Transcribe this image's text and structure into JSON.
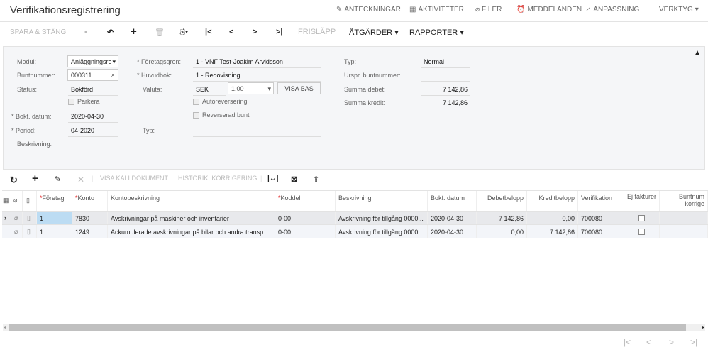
{
  "title": "Verifikationsregistrering",
  "topnav": [
    {
      "icon": "note-icon",
      "label": "ANTECKNINGAR"
    },
    {
      "icon": "calendar-icon",
      "label": "AKTIVITETER"
    },
    {
      "icon": "paperclip-icon",
      "label": "FILER"
    },
    {
      "icon": "alarm-icon",
      "label": "MEDDELANDEN"
    },
    {
      "icon": "customize-icon",
      "label": "ANPASSNING"
    },
    {
      "icon": "chevron-down-icon",
      "label": "VERKTYG"
    }
  ],
  "toolbar": {
    "save_close": "SPARA & STÄNG",
    "release": "FRISLÄPP",
    "actions": "ÅTGÄRDER",
    "reports": "RAPPORTER"
  },
  "form": {
    "modul_label": "Modul:",
    "modul": "Anläggningsre",
    "batch_label": "Buntnummer:",
    "batch": "000311",
    "status_label": "Status:",
    "status": "Bokförd",
    "hold_label": "Parkera",
    "date_label": "Bokf. datum:",
    "date": "2020-04-30",
    "period_label": "Period:",
    "period": "04-2020",
    "desc_label": "Beskrivning:",
    "desc": "",
    "branch_label": "Företagsgren:",
    "branch": "1 - VNF Test-Joakim Arvidsson",
    "ledger_label": "Huvudbok:",
    "ledger": "1 - Redovisning",
    "currency_label": "Valuta:",
    "currency": "SEK",
    "rate": "1,00",
    "view_base": "VISA BAS",
    "autorev_label": "Autoreversering",
    "reversed_label": "Reverserad bunt",
    "typ2_label": "Typ:",
    "typ2": "",
    "type_label": "Typ:",
    "type": "Normal",
    "orig_label": "Urspr. buntnummer:",
    "orig": "",
    "debit_label": "Summa debet:",
    "debit": "7 142,86",
    "credit_label": "Summa kredit:",
    "credit": "7 142,86"
  },
  "grid_toolbar": {
    "view_source": "VISA KÄLLDOKUMENT",
    "history": "HISTORIK, KORRIGERING"
  },
  "columns": [
    "Företag",
    "Konto",
    "Kontobeskrivning",
    "Koddel",
    "Beskrivning",
    "Bokf. datum",
    "Debetbelopp",
    "Kreditbelopp",
    "Verifikation",
    "Ej fakturer",
    "Buntnum korrige"
  ],
  "rows": [
    [
      "1",
      "7830",
      "Avskrivningar på maskiner och inventarier",
      "0-00",
      "Avskrivning för tillgång 0000...",
      "2020-04-30",
      "7 142,86",
      "0,00",
      "700080"
    ],
    [
      "1",
      "1249",
      "Ackumulerade avskrivningar på bilar och andra transpor...",
      "0-00",
      "Avskrivning för tillgång 0000...",
      "2020-04-30",
      "0,00",
      "7 142,86",
      "700080"
    ]
  ]
}
